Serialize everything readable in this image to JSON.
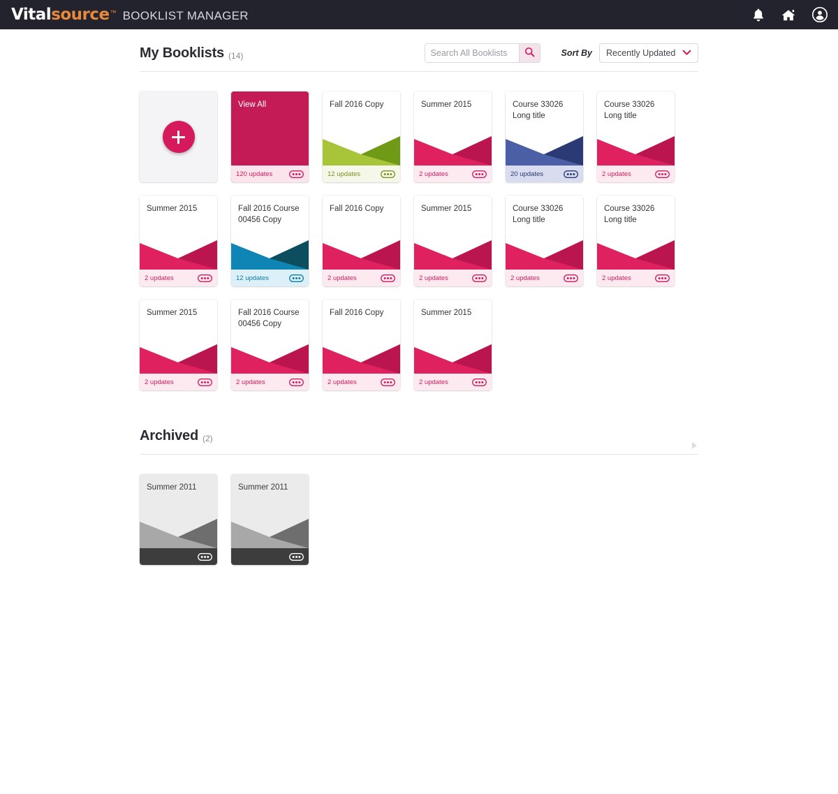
{
  "header": {
    "logo_primary": "Vital",
    "logo_secondary": "source",
    "logo_tm": "™",
    "app_name": "BOOKLIST MANAGER",
    "icons": [
      "bell-icon",
      "home-icon",
      "account-icon"
    ]
  },
  "toolbar": {
    "title": "My Booklists",
    "count": "(14)",
    "search_placeholder": "Search All Booklists",
    "search_value": "",
    "search_icon": "search-icon",
    "sort_label": "Sort By",
    "sort_value": "Recently Updated",
    "sort_options": [
      "Recently Updated"
    ]
  },
  "archived_section": {
    "title": "Archived",
    "count": "(2)",
    "toggle_icon": "expand-arrow-icon"
  },
  "colors": {
    "brand_crimson": "#d6195c",
    "crimson_dark": "#bb1550",
    "green_light": "#a8c53a",
    "green_dark": "#6f9a15",
    "blue_light": "#4a5fa5",
    "blue_dark": "#2b3a75",
    "teal_light": "#0f85b5",
    "teal_dark": "#0c4d5e",
    "gray_light": "#a8a8a8",
    "gray_dark": "#6e6e6e",
    "topbar_bg": "#23232e",
    "logo_orange": "#e8883a"
  },
  "add_card": {
    "name": "Add new booklist",
    "icon": "plus-icon"
  },
  "cards": [
    {
      "title": "View All",
      "updates": "120 updates",
      "theme": "solid-crimson",
      "art": "none",
      "footer_bg": "#fbe4ec",
      "footer_text": "#d6195c",
      "body_bg": "#c41a55",
      "menu_icon": "more-options-icon"
    },
    {
      "title": "Fall 2016 Copy",
      "updates": "12 updates",
      "theme": "green",
      "art": "wave",
      "art_light": "#a8c53a",
      "art_dark": "#6f9a15",
      "footer_bg": "#f5f8e8",
      "footer_text": "#78931f",
      "body_bg": "#ffffff",
      "menu_icon": "more-options-icon"
    },
    {
      "title": "Summer 2015",
      "updates": "2 updates",
      "theme": "crimson",
      "art": "wave",
      "art_light": "#e0215f",
      "art_dark": "#bb1550",
      "footer_bg": "#fdeaf1",
      "footer_text": "#d6195c",
      "body_bg": "#ffffff",
      "menu_icon": "more-options-icon"
    },
    {
      "title": "Course 33026 Long title",
      "updates": "20 updates",
      "theme": "blue",
      "art": "wave",
      "art_light": "#4a5fa5",
      "art_dark": "#2b3a75",
      "footer_bg": "#d8dcee",
      "footer_text": "#2b3a75",
      "body_bg": "#ffffff",
      "menu_icon": "more-options-icon"
    },
    {
      "title": "Course 33026 Long title",
      "updates": "2 updates",
      "theme": "crimson",
      "art": "wave",
      "art_light": "#e0215f",
      "art_dark": "#bb1550",
      "footer_bg": "#fdeaf1",
      "footer_text": "#d6195c",
      "body_bg": "#ffffff",
      "menu_icon": "more-options-icon"
    },
    {
      "title": "Summer 2015",
      "updates": "2 updates",
      "theme": "crimson",
      "art": "wave",
      "art_light": "#e0215f",
      "art_dark": "#bb1550",
      "footer_bg": "#fdeaf1",
      "footer_text": "#d6195c",
      "body_bg": "#ffffff",
      "menu_icon": "more-options-icon"
    },
    {
      "title": "Fall 2016 Course 00456 Copy",
      "updates": "12 updates",
      "theme": "teal",
      "art": "wave",
      "art_light": "#0f85b5",
      "art_dark": "#0c4d5e",
      "footer_bg": "#dbf0f8",
      "footer_text": "#0f7ba6",
      "body_bg": "#ffffff",
      "menu_icon": "more-options-icon"
    },
    {
      "title": "Fall 2016 Copy",
      "updates": "2 updates",
      "theme": "crimson",
      "art": "wave",
      "art_light": "#e0215f",
      "art_dark": "#bb1550",
      "footer_bg": "#fdeaf1",
      "footer_text": "#d6195c",
      "body_bg": "#ffffff",
      "menu_icon": "more-options-icon"
    },
    {
      "title": "Summer 2015",
      "updates": "2 updates",
      "theme": "crimson",
      "art": "wave",
      "art_light": "#e0215f",
      "art_dark": "#bb1550",
      "footer_bg": "#fdeaf1",
      "footer_text": "#d6195c",
      "body_bg": "#ffffff",
      "menu_icon": "more-options-icon"
    },
    {
      "title": "Course 33026 Long title",
      "updates": "2 updates",
      "theme": "crimson",
      "art": "wave",
      "art_light": "#e0215f",
      "art_dark": "#bb1550",
      "footer_bg": "#fdeaf1",
      "footer_text": "#d6195c",
      "body_bg": "#ffffff",
      "menu_icon": "more-options-icon"
    },
    {
      "title": "Course 33026 Long title",
      "updates": "2 updates",
      "theme": "crimson",
      "art": "wave",
      "art_light": "#e0215f",
      "art_dark": "#bb1550",
      "footer_bg": "#fdeaf1",
      "footer_text": "#d6195c",
      "body_bg": "#ffffff",
      "menu_icon": "more-options-icon"
    },
    {
      "title": "Summer 2015",
      "updates": "2 updates",
      "theme": "crimson",
      "art": "wave",
      "art_light": "#e0215f",
      "art_dark": "#bb1550",
      "footer_bg": "#fdeaf1",
      "footer_text": "#d6195c",
      "body_bg": "#ffffff",
      "menu_icon": "more-options-icon"
    },
    {
      "title": "Fall 2016 Course 00456 Copy",
      "updates": "2 updates",
      "theme": "crimson",
      "art": "wave",
      "art_light": "#e0215f",
      "art_dark": "#bb1550",
      "footer_bg": "#fdeaf1",
      "footer_text": "#d6195c",
      "body_bg": "#ffffff",
      "menu_icon": "more-options-icon"
    },
    {
      "title": "Fall 2016 Copy",
      "updates": "2 updates",
      "theme": "crimson",
      "art": "wave",
      "art_light": "#e0215f",
      "art_dark": "#bb1550",
      "footer_bg": "#fdeaf1",
      "footer_text": "#d6195c",
      "body_bg": "#ffffff",
      "menu_icon": "more-options-icon"
    },
    {
      "title": "Summer 2015",
      "updates": "2 updates",
      "theme": "crimson",
      "art": "wave",
      "art_light": "#e0215f",
      "art_dark": "#bb1550",
      "footer_bg": "#fdeaf1",
      "footer_text": "#d6195c",
      "body_bg": "#ffffff",
      "menu_icon": "more-options-icon"
    }
  ],
  "archived_cards": [
    {
      "title": "Summer 2011",
      "updates": "",
      "theme": "archived",
      "art": "wave",
      "art_light": "#a8a8a8",
      "art_dark": "#6e6e6e",
      "footer_bg": "#3d3d3d",
      "footer_text": "#ffffff",
      "body_bg": "#ebebeb",
      "menu_icon": "more-options-icon"
    },
    {
      "title": "Summer 2011",
      "updates": "",
      "theme": "archived",
      "art": "wave",
      "art_light": "#a8a8a8",
      "art_dark": "#6e6e6e",
      "footer_bg": "#3d3d3d",
      "footer_text": "#ffffff",
      "body_bg": "#ebebeb",
      "menu_icon": "more-options-icon"
    }
  ]
}
